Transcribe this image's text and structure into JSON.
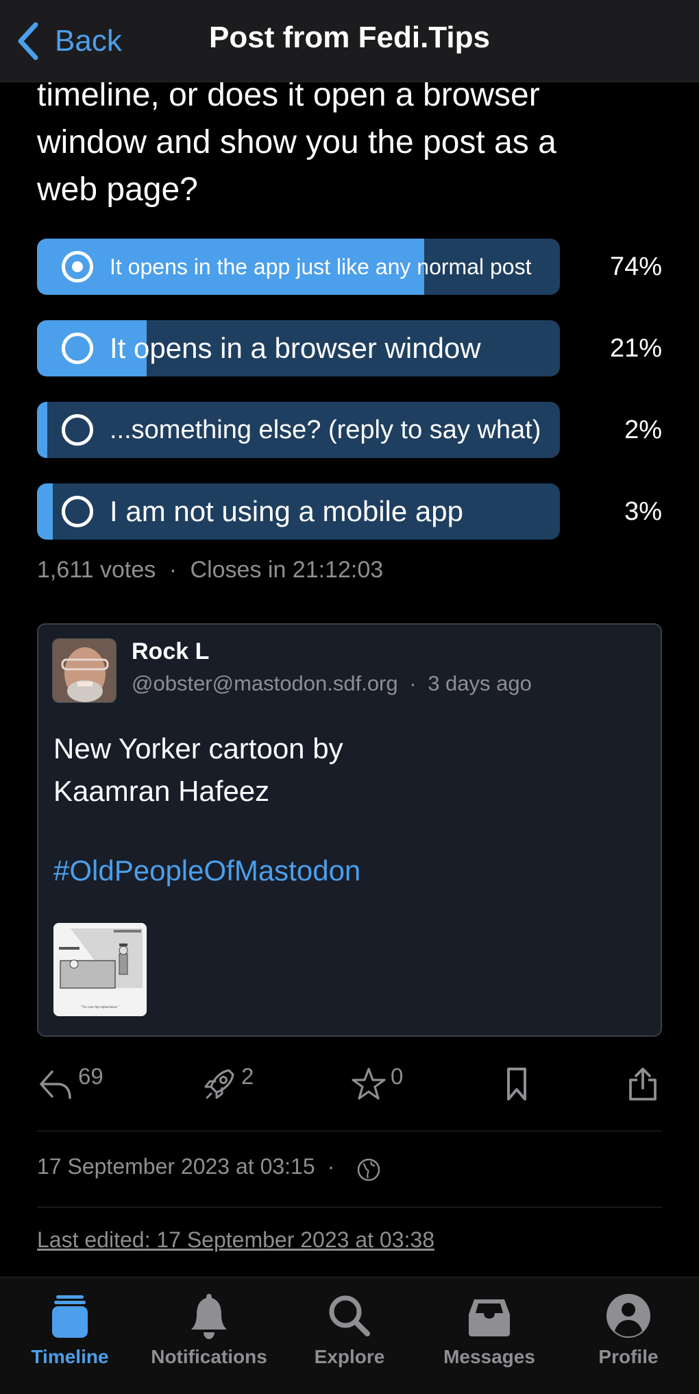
{
  "nav": {
    "back_label": "Back",
    "title": "Post from Fedi.Tips"
  },
  "post": {
    "question_lines": [
      "timeline, or does it open a browser",
      "window and show you the post as a",
      "web page?"
    ],
    "poll": {
      "options": [
        {
          "label": "It opens in the app just like any normal post",
          "percent": 74,
          "percent_label": "74%",
          "selected": true
        },
        {
          "label": "It opens in a browser window",
          "percent": 21,
          "percent_label": "21%",
          "selected": false
        },
        {
          "label": "...something else? (reply to say what)",
          "percent": 2,
          "percent_label": "2%",
          "selected": false
        },
        {
          "label": "I am not using a mobile app",
          "percent": 3,
          "percent_label": "3%",
          "selected": false
        }
      ],
      "votes": "1,611 votes",
      "separator": "·",
      "closes": "Closes in 21:12:03"
    },
    "quoted": {
      "author_name": "Rock L",
      "handle": "@obster@mastodon.sdf.org",
      "separator": "·",
      "relative_time": "3 days ago",
      "body_lines": [
        "New Yorker cartoon by",
        "Kaamran Hafeez"
      ],
      "hashtag": "#OldPeopleOfMastodon",
      "attachment_caption": "\"I'm your hip replacement.\""
    },
    "actions": {
      "replies": "69",
      "boosts": "2",
      "favourites": "0",
      "bookmark_icon": "bookmark-icon",
      "share_icon": "share-icon"
    },
    "timestamp": "17 September 2023 at 03:15",
    "timestamp_separator": "·",
    "visibility_icon": "globe-icon",
    "last_edited": "Last edited: 17 September 2023 at 03:38"
  },
  "tabbar": {
    "items": [
      {
        "label": "Timeline",
        "icon": "timeline-icon",
        "active": true
      },
      {
        "label": "Notifications",
        "icon": "bell-icon",
        "active": false
      },
      {
        "label": "Explore",
        "icon": "search-icon",
        "active": false
      },
      {
        "label": "Messages",
        "icon": "inbox-icon",
        "active": false
      },
      {
        "label": "Profile",
        "icon": "profile-icon",
        "active": false
      }
    ]
  },
  "colors": {
    "accent": "#4c9fea",
    "poll_track": "#1f3f60",
    "secondary_text": "#8e8e93",
    "card_bg": "#181d28"
  }
}
